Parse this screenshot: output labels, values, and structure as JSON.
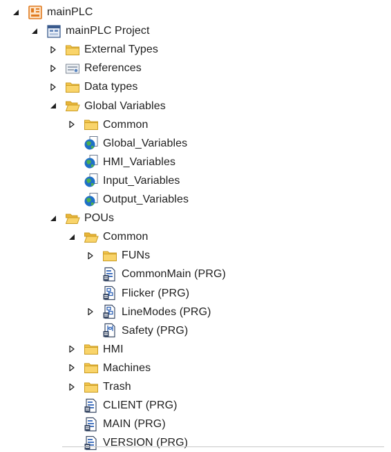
{
  "tree": {
    "nodes": [
      {
        "label": "mainPLC",
        "icon": "plc-icon",
        "state": "expanded"
      },
      {
        "label": "mainPLC Project",
        "icon": "project-icon",
        "state": "expanded"
      },
      {
        "label": "External Types",
        "icon": "folder-icon",
        "state": "collapsed"
      },
      {
        "label": "References",
        "icon": "references-icon",
        "state": "collapsed"
      },
      {
        "label": "Data types",
        "icon": "folder-icon",
        "state": "collapsed"
      },
      {
        "label": "Global Variables",
        "icon": "folder-open-icon",
        "state": "expanded"
      },
      {
        "label": "Common",
        "icon": "folder-icon",
        "state": "collapsed"
      },
      {
        "label": "Global_Variables",
        "icon": "gvl-icon",
        "state": "leaf"
      },
      {
        "label": "HMI_Variables",
        "icon": "gvl-icon",
        "state": "leaf"
      },
      {
        "label": "Input_Variables",
        "icon": "gvl-icon",
        "state": "leaf"
      },
      {
        "label": "Output_Variables",
        "icon": "gvl-icon",
        "state": "leaf"
      },
      {
        "label": "POUs",
        "icon": "folder-open-icon",
        "state": "expanded"
      },
      {
        "label": "Common",
        "icon": "folder-open-icon",
        "state": "expanded"
      },
      {
        "label": "FUNs",
        "icon": "folder-icon",
        "state": "collapsed"
      },
      {
        "label": "CommonMain (PRG)",
        "icon": "program-st-icon",
        "state": "leaf"
      },
      {
        "label": "Flicker (PRG)",
        "icon": "program-cfc-icon",
        "state": "leaf"
      },
      {
        "label": "LineModes (PRG)",
        "icon": "program-cfc-icon",
        "state": "collapsed"
      },
      {
        "label": "Safety (PRG)",
        "icon": "program-ld-icon",
        "state": "leaf"
      },
      {
        "label": "HMI",
        "icon": "folder-icon",
        "state": "collapsed"
      },
      {
        "label": "Machines",
        "icon": "folder-icon",
        "state": "collapsed"
      },
      {
        "label": "Trash",
        "icon": "folder-icon",
        "state": "collapsed"
      },
      {
        "label": "CLIENT (PRG)",
        "icon": "program-st-icon",
        "state": "leaf"
      },
      {
        "label": "MAIN (PRG)",
        "icon": "program-st-icon",
        "state": "leaf"
      },
      {
        "label": "VERSION (PRG)",
        "icon": "program-st-icon",
        "state": "leaf"
      }
    ]
  },
  "colors": {
    "text": "#1e1e1e",
    "folder_fill": "#f5c74e",
    "folder_edge": "#c99a1e",
    "plc_orange": "#e07a1f",
    "globe_blue": "#1e6fc7",
    "globe_green": "#4caf50",
    "doc_blue": "#2f63b8",
    "arrow": "#1e1e1e"
  }
}
